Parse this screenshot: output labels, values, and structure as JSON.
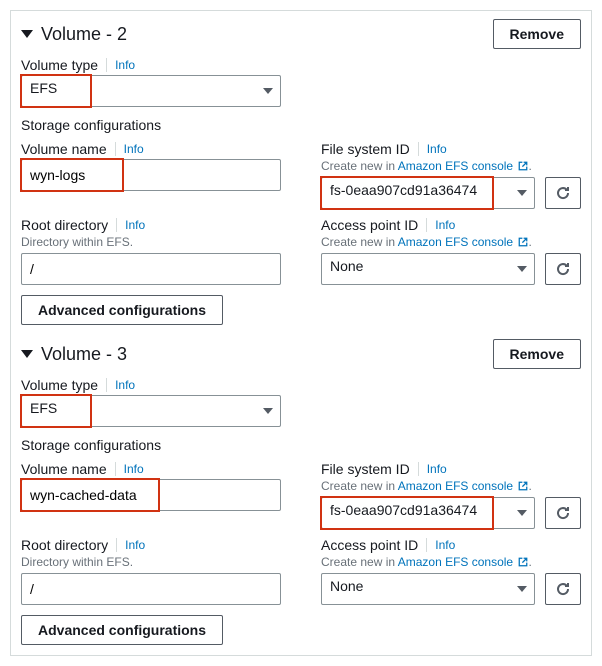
{
  "volumes": [
    {
      "title": "Volume - 2",
      "remove": "Remove",
      "type_label": "Volume type",
      "info": "Info",
      "type_value": "EFS",
      "storage_cfg": "Storage configurations",
      "name_label": "Volume name",
      "name_value": "wyn-logs",
      "fs_label": "File system ID",
      "fs_helper_prefix": "Create new in ",
      "fs_helper_link": "Amazon EFS console",
      "fs_value": "fs-0eaa907cd91a36474",
      "root_label": "Root directory",
      "root_helper": "Directory within EFS.",
      "root_value": "/",
      "ap_label": "Access point ID",
      "ap_value": "None",
      "adv": "Advanced configurations"
    },
    {
      "title": "Volume - 3",
      "remove": "Remove",
      "type_label": "Volume type",
      "info": "Info",
      "type_value": "EFS",
      "storage_cfg": "Storage configurations",
      "name_label": "Volume name",
      "name_value": "wyn-cached-data",
      "fs_label": "File system ID",
      "fs_helper_prefix": "Create new in ",
      "fs_helper_link": "Amazon EFS console",
      "fs_value": "fs-0eaa907cd91a36474",
      "root_label": "Root directory",
      "root_helper": "Directory within EFS.",
      "root_value": "/",
      "ap_label": "Access point ID",
      "ap_value": "None",
      "adv": "Advanced configurations"
    }
  ]
}
